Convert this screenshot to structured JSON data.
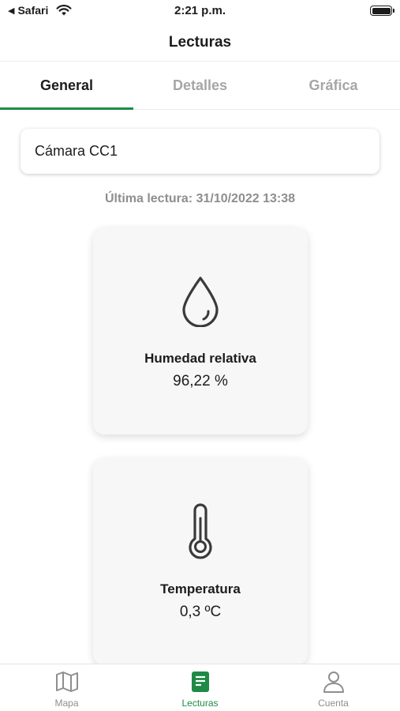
{
  "status_bar": {
    "back_app": "Safari",
    "time": "2:21 p.m."
  },
  "header": {
    "title": "Lecturas"
  },
  "tabs": [
    {
      "label": "General",
      "active": true
    },
    {
      "label": "Detalles",
      "active": false
    },
    {
      "label": "Gráfica",
      "active": false
    }
  ],
  "selector": {
    "value": "Cámara CC1"
  },
  "last_reading": "Última lectura: 31/10/2022 13:38",
  "cards": {
    "humidity": {
      "icon": "droplet-icon",
      "label": "Humedad relativa",
      "value": "96,22 %"
    },
    "temperature": {
      "icon": "thermometer-icon",
      "label": "Temperatura",
      "value": "0,3 ºC"
    }
  },
  "bottom_nav": [
    {
      "label": "Mapa",
      "icon": "map-icon",
      "active": false
    },
    {
      "label": "Lecturas",
      "icon": "readings-icon",
      "active": true
    },
    {
      "label": "Cuenta",
      "icon": "user-icon",
      "active": false
    }
  ],
  "colors": {
    "accent": "#1e8a46",
    "inactive": "#a6a6a6"
  }
}
